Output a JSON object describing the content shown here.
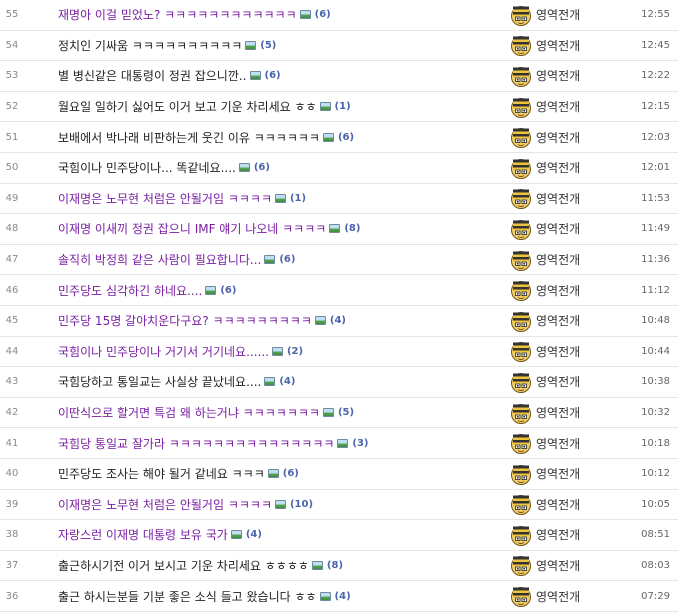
{
  "board": {
    "posts": [
      {
        "num": "55",
        "title": "재명아 이걸 믿었노? ㅋㅋㅋㅋㅋㅋㅋㅋㅋㅋㅋㅋ",
        "comments": "(6)",
        "writer": "영역전개",
        "time": "12:55",
        "visited": false
      },
      {
        "num": "54",
        "title": "정치인 기싸움 ㅋㅋㅋㅋㅋㅋㅋㅋㅋㅋ",
        "comments": "(5)",
        "writer": "영역전개",
        "time": "12:45",
        "visited": true
      },
      {
        "num": "53",
        "title": "별 병신같은 대통령이 정권 잡으니깐..",
        "comments": "(6)",
        "writer": "영역전개",
        "time": "12:22",
        "visited": true
      },
      {
        "num": "52",
        "title": "월요일 일하기 싫어도 이거 보고 기운 차리세요 ㅎㅎ",
        "comments": "(1)",
        "writer": "영역전개",
        "time": "12:15",
        "visited": true
      },
      {
        "num": "51",
        "title": "보배에서 박나래 비판하는게 웃긴 이유 ㅋㅋㅋㅋㅋㅋ",
        "comments": "(6)",
        "writer": "영역전개",
        "time": "12:03",
        "visited": true
      },
      {
        "num": "50",
        "title": "국힘이나 민주당이나... 똑같네요....",
        "comments": "(6)",
        "writer": "영역전개",
        "time": "12:01",
        "visited": true
      },
      {
        "num": "49",
        "title": "이재명은 노무현 처럼은 안될거임 ㅋㅋㅋㅋ",
        "comments": "(1)",
        "writer": "영역전개",
        "time": "11:53",
        "visited": false
      },
      {
        "num": "48",
        "title": "이재명 이새끼 정권 잡으니 IMF 얘기 나오네 ㅋㅋㅋㅋ",
        "comments": "(8)",
        "writer": "영역전개",
        "time": "11:49",
        "visited": false
      },
      {
        "num": "47",
        "title": "솔직히 박정희 같은 사람이 필요합니다...",
        "comments": "(6)",
        "writer": "영역전개",
        "time": "11:36",
        "visited": false
      },
      {
        "num": "46",
        "title": "민주당도 심각하긴 하네요....",
        "comments": "(6)",
        "writer": "영역전개",
        "time": "11:12",
        "visited": false
      },
      {
        "num": "45",
        "title": "민주당 15명 갈아치운다구요? ㅋㅋㅋㅋㅋㅋㅋㅋㅋ",
        "comments": "(4)",
        "writer": "영역전개",
        "time": "10:48",
        "visited": false
      },
      {
        "num": "44",
        "title": "국힘이나 민주당이나 거기서 거기네요......",
        "comments": "(2)",
        "writer": "영역전개",
        "time": "10:44",
        "visited": false
      },
      {
        "num": "43",
        "title": "국힘당하고 통일교는 사실상 끝났네요....",
        "comments": "(4)",
        "writer": "영역전개",
        "time": "10:38",
        "visited": true
      },
      {
        "num": "42",
        "title": "이딴식으로 할거면 특검 왜 하는거냐 ㅋㅋㅋㅋㅋㅋㅋ",
        "comments": "(5)",
        "writer": "영역전개",
        "time": "10:32",
        "visited": false
      },
      {
        "num": "41",
        "title": "국힘당 통일교 잘가라 ㅋㅋㅋㅋㅋㅋㅋㅋㅋㅋㅋㅋㅋㅋㅋ",
        "comments": "(3)",
        "writer": "영역전개",
        "time": "10:18",
        "visited": false
      },
      {
        "num": "40",
        "title": "민주당도 조사는 해야 될거 같네요 ㅋㅋㅋ",
        "comments": "(6)",
        "writer": "영역전개",
        "time": "10:12",
        "visited": true
      },
      {
        "num": "39",
        "title": "이재명은 노무현 처럼은 안될거임 ㅋㅋㅋㅋ",
        "comments": "(10)",
        "writer": "영역전개",
        "time": "10:05",
        "visited": false
      },
      {
        "num": "38",
        "title": "자랑스런 이재명 대통령 보유 국가",
        "comments": "(4)",
        "writer": "영역전개",
        "time": "08:51",
        "visited": false
      },
      {
        "num": "37",
        "title": "출근하시기전 이거 보시고 기운 차리세요 ㅎㅎㅎㅎ",
        "comments": "(8)",
        "writer": "영역전개",
        "time": "08:03",
        "visited": true
      },
      {
        "num": "36",
        "title": "출근 하시는분들 기분 좋은 소식 들고 왔습니다 ㅎㅎ",
        "comments": "(4)",
        "writer": "영역전개",
        "time": "07:29",
        "visited": true
      }
    ]
  },
  "icons": {
    "image_attachment": "image-attachment-icon",
    "avatar": "striped-hat-avatar-icon"
  },
  "colors": {
    "unvisited_title": "#7a1fa2",
    "visited_title": "#222222",
    "comment_count": "#4a64ad",
    "row_divider": "#e6e6e6"
  }
}
